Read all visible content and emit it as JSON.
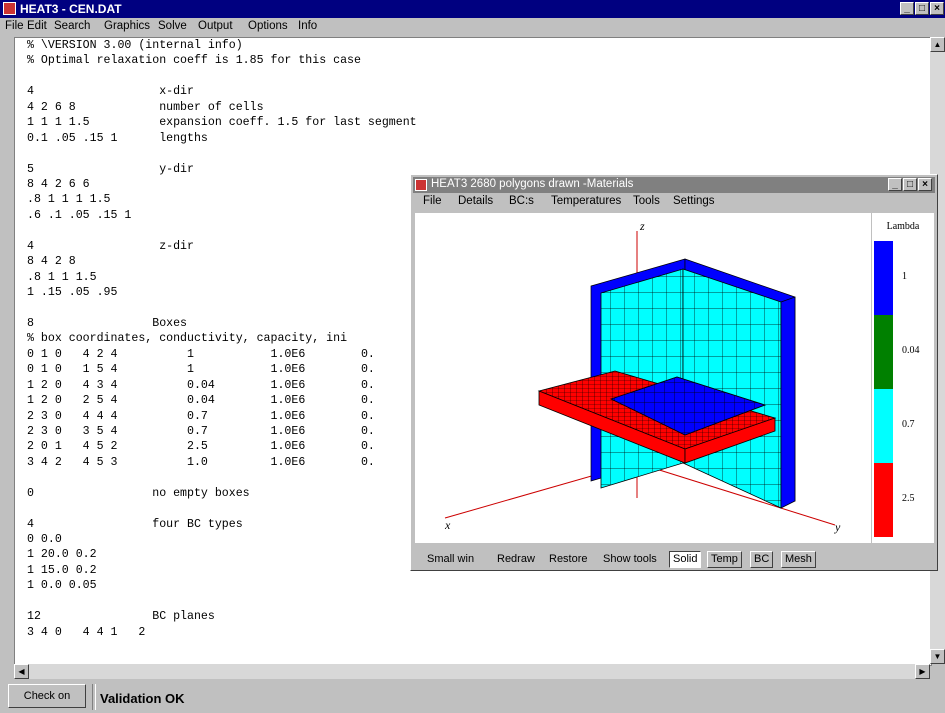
{
  "window": {
    "title": "HEAT3 - CEN.DAT"
  },
  "menu": [
    "File",
    "Edit",
    "Search",
    "Graphics",
    "Solve",
    "Output",
    "Options",
    "Info"
  ],
  "editor": {
    "lines": [
      "% \\VERSION 3.00 (internal info)",
      "% Optimal relaxation coeff is 1.85 for this case",
      "",
      "4                  x-dir",
      "4 2 6 8            number of cells",
      "1 1 1 1.5          expansion coeff. 1.5 for last segment",
      "0.1 .05 .15 1      lengths",
      "",
      "5                  y-dir",
      "8 4 2 6 6",
      ".8 1 1 1 1.5",
      ".6 .1 .05 .15 1",
      "",
      "4                  z-dir",
      "8 4 2 8",
      ".8 1 1 1.5",
      "1 .15 .05 .95",
      "",
      "8                 Boxes",
      "% box coordinates, conductivity, capacity, ini",
      "0 1 0   4 2 4          1           1.0E6        0.",
      "0 1 0   1 5 4          1           1.0E6        0.",
      "1 2 0   4 3 4          0.04        1.0E6        0.",
      "1 2 0   2 5 4          0.04        1.0E6        0.",
      "2 3 0   4 4 4          0.7         1.0E6        0.",
      "2 3 0   3 5 4          0.7         1.0E6        0.",
      "2 0 1   4 5 2          2.5         1.0E6        0.",
      "3 4 2   4 5 3          1.0         1.0E6        0.",
      "",
      "0                 no empty boxes",
      "",
      "4                 four BC types",
      "0 0.0",
      "1 20.0 0.2",
      "1 15.0 0.2",
      "1 0.0 0.05",
      "",
      "12                BC planes",
      "3 4 0   4 4 1   2"
    ]
  },
  "child": {
    "title": "HEAT3 2680 polygons drawn -Materials",
    "menu": [
      "File",
      "Details",
      "BC:s",
      "Temperatures",
      "Tools",
      "Settings"
    ],
    "axes": {
      "x": "x",
      "y": "y",
      "z": "z"
    },
    "legend": {
      "title": "Lambda",
      "items": [
        {
          "value": "1",
          "color": "#0000ff"
        },
        {
          "value": "0.04",
          "color": "#008000"
        },
        {
          "value": "0.7",
          "color": "#00ffff"
        },
        {
          "value": "2.5",
          "color": "#ff0000"
        }
      ]
    },
    "toolbar": {
      "small_win": "Small win",
      "redraw": "Redraw",
      "restore": "Restore",
      "show_tools": "Show tools",
      "solid": "Solid",
      "temp": "Temp",
      "bc": "BC",
      "mesh": "Mesh"
    }
  },
  "status": {
    "check_button": "Check on",
    "message": "Validation OK"
  }
}
